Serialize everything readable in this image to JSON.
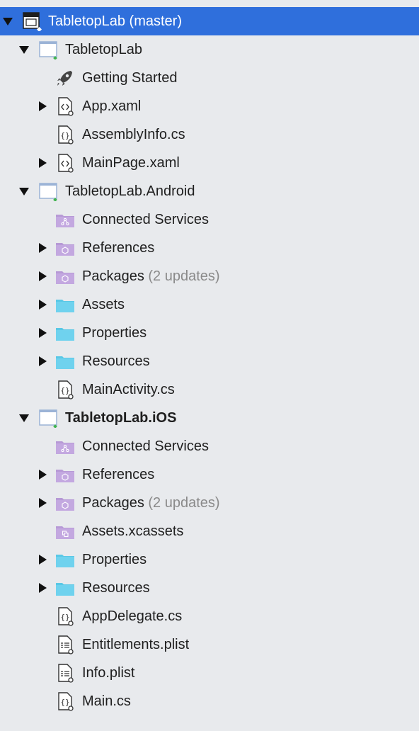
{
  "tree": {
    "solution": {
      "label": "TabletopLab (master)",
      "icon": "solution-icon"
    },
    "projects": [
      {
        "label": "TabletopLab",
        "items": [
          {
            "label": "Getting Started",
            "icon": "rocket-icon"
          },
          {
            "label": "App.xaml",
            "icon": "xaml-file-icon",
            "expandable": true
          },
          {
            "label": "AssemblyInfo.cs",
            "icon": "csharp-file-icon"
          },
          {
            "label": "MainPage.xaml",
            "icon": "xaml-file-icon",
            "expandable": true
          }
        ]
      },
      {
        "label": "TabletopLab.Android",
        "items": [
          {
            "label": "Connected Services",
            "icon": "connected-services-icon"
          },
          {
            "label": "References",
            "icon": "references-icon",
            "expandable": true
          },
          {
            "label": "Packages",
            "suffix": "(2 updates)",
            "icon": "packages-icon",
            "expandable": true
          },
          {
            "label": "Assets",
            "icon": "folder-icon",
            "expandable": true
          },
          {
            "label": "Properties",
            "icon": "folder-icon",
            "expandable": true
          },
          {
            "label": "Resources",
            "icon": "folder-icon",
            "expandable": true
          },
          {
            "label": "MainActivity.cs",
            "icon": "csharp-file-icon"
          }
        ]
      },
      {
        "label": "TabletopLab.iOS",
        "bold": true,
        "items": [
          {
            "label": "Connected Services",
            "icon": "connected-services-icon"
          },
          {
            "label": "References",
            "icon": "references-icon",
            "expandable": true
          },
          {
            "label": "Packages",
            "suffix": "(2 updates)",
            "icon": "packages-icon",
            "expandable": true
          },
          {
            "label": "Assets.xcassets",
            "icon": "xcassets-icon"
          },
          {
            "label": "Properties",
            "icon": "folder-icon",
            "expandable": true
          },
          {
            "label": "Resources",
            "icon": "folder-icon",
            "expandable": true
          },
          {
            "label": "AppDelegate.cs",
            "icon": "csharp-file-icon"
          },
          {
            "label": "Entitlements.plist",
            "icon": "plist-file-icon"
          },
          {
            "label": "Info.plist",
            "icon": "plist-file-icon"
          },
          {
            "label": "Main.cs",
            "icon": "csharp-file-icon"
          }
        ]
      }
    ]
  },
  "colors": {
    "selection": "#2f6fdc",
    "background": "#e8eaed",
    "folder": "#5ac8e6",
    "purple_folder": "#b79ad6",
    "muted_text": "#8a8a8a"
  }
}
